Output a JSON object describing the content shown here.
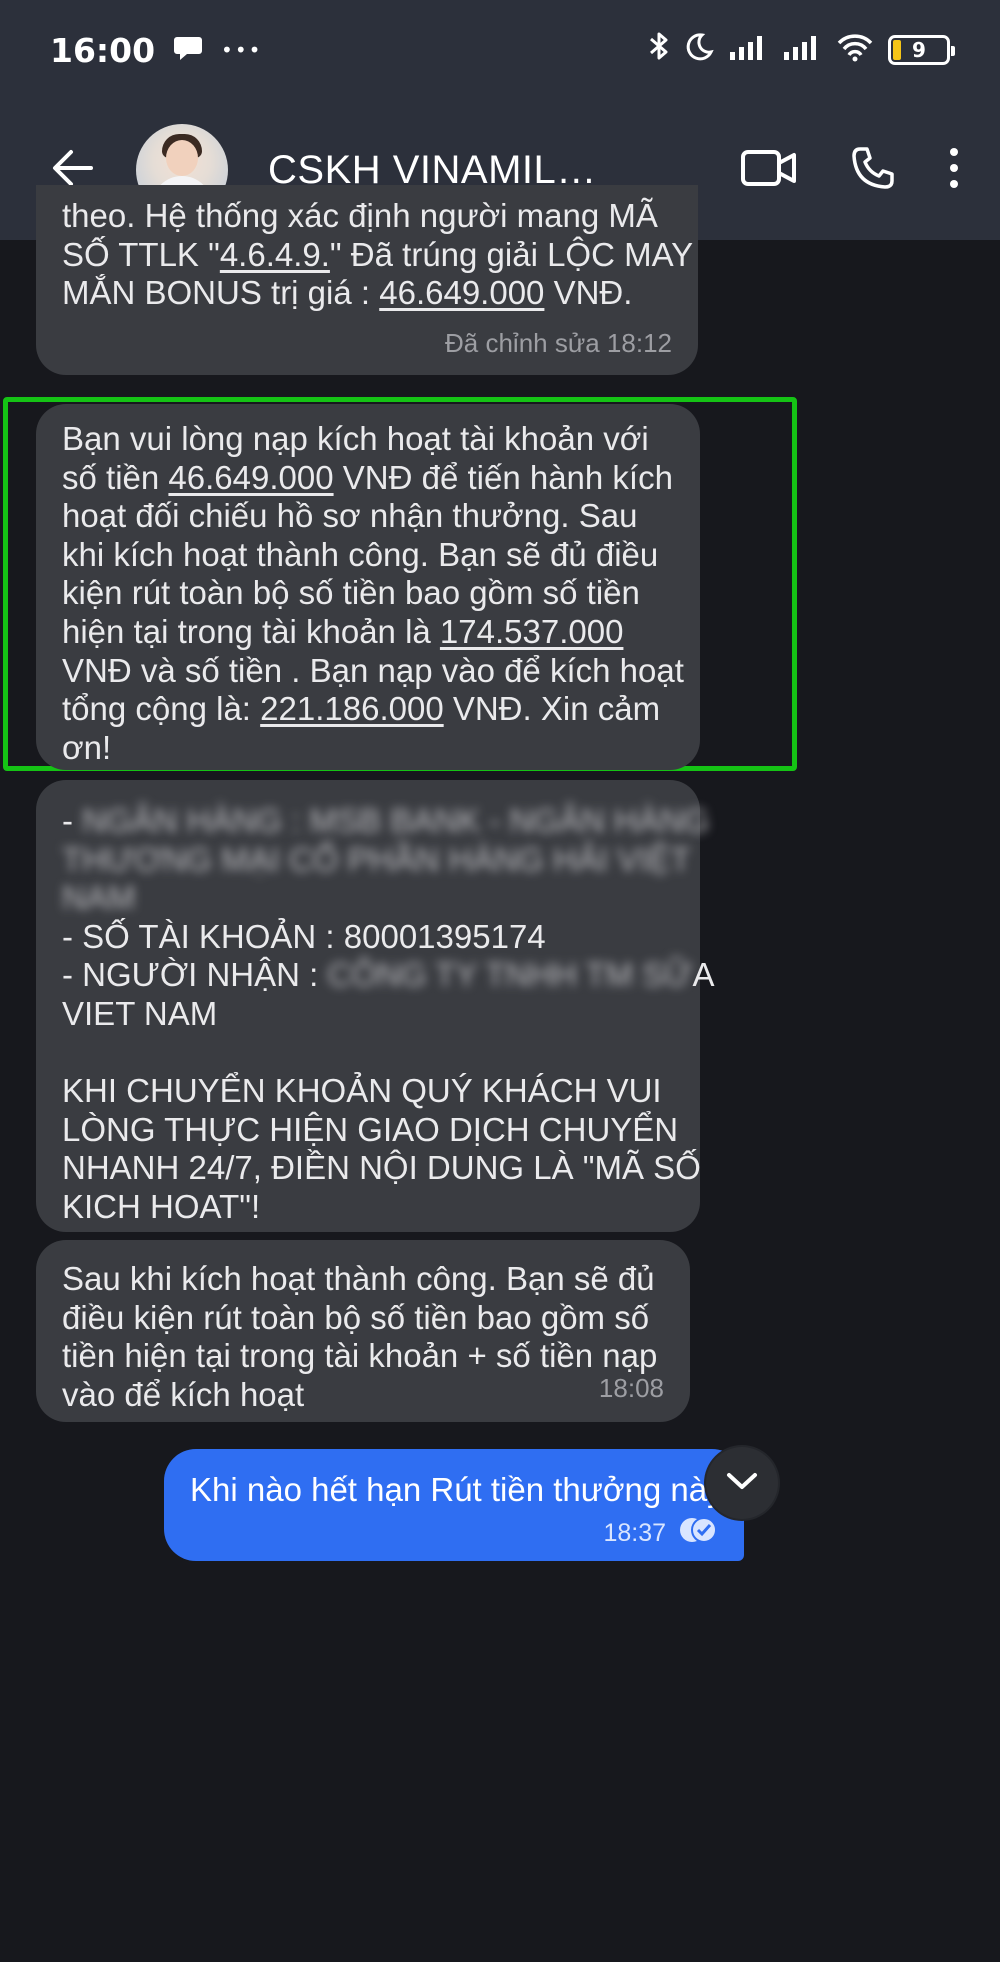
{
  "status_bar": {
    "time": "16:00",
    "dots": "•••",
    "battery": "9"
  },
  "header": {
    "contact_name": "CSKH VINAMIL…"
  },
  "messages": [
    {
      "lines": [
        [
          {
            "t": "theo. Hệ thống xác định người mang MÃ"
          }
        ],
        [
          {
            "t": "SỐ TTLK \""
          },
          {
            "t": "4.6.4.9.",
            "u": true
          },
          {
            "t": "\" Đã trúng giải LỘC MAY"
          }
        ],
        [
          {
            "t": "MẮN BONUS trị giá : "
          },
          {
            "t": "46.649.000",
            "u": true
          },
          {
            "t": " VNĐ."
          }
        ]
      ],
      "meta": "Đã chỉnh sửa 18:12"
    },
    {
      "lines": [
        [
          {
            "t": "Bạn vui lòng nạp kích hoạt tài khoản với"
          }
        ],
        [
          {
            "t": "số tiền "
          },
          {
            "t": "46.649.000",
            "u": true
          },
          {
            "t": " VNĐ để tiến hành kích"
          }
        ],
        [
          {
            "t": "hoạt đối chiếu hồ sơ nhận thưởng. Sau"
          }
        ],
        [
          {
            "t": "khi kích hoạt thành công. Bạn sẽ đủ điều"
          }
        ],
        [
          {
            "t": "kiện rút toàn bộ số tiền bao gồm số tiền"
          }
        ],
        [
          {
            "t": "hiện tại trong tài khoản là "
          },
          {
            "t": "174.537.000",
            "u": true
          }
        ],
        [
          {
            "t": "VNĐ và số tiền . Bạn nạp vào để kích hoạt"
          }
        ],
        [
          {
            "t": "tổng cộng là: "
          },
          {
            "t": "221.186.000",
            "u": true
          },
          {
            "t": " VNĐ. Xin cảm"
          }
        ],
        [
          {
            "t": "ơn!"
          }
        ]
      ]
    },
    {
      "lines": [
        [
          {
            "t": "- "
          },
          {
            "t": "NGÂN HÀNG : MSB BANK - NGÂN HÀNG",
            "blur": true
          }
        ],
        [
          {
            "t": "THƯƠNG MẠI CỔ PHẦN HÀNG HẢI VIỆT",
            "blur": true
          }
        ],
        [
          {
            "t": "NAM",
            "blur": true
          }
        ],
        [
          {
            "t": "- SỐ TÀI KHOẢN : 80001395174"
          }
        ],
        [
          {
            "t": "- NGƯỜI NHẬN : "
          },
          {
            "t": "CÔNG TY TNHH TM SỮ",
            "blur": true
          },
          {
            "t": "A"
          }
        ],
        [
          {
            "t": "VIET NAM"
          }
        ],
        [
          {
            "t": " "
          }
        ],
        [
          {
            "t": "KHI CHUYỂN KHOẢN QUÝ KHÁCH VUI"
          }
        ],
        [
          {
            "t": "LÒNG THỰC HIỆN GIAO DỊCH CHUYỂN"
          }
        ],
        [
          {
            "t": "NHANH 24/7, ĐIỀN NỘI DUNG LÀ \"MÃ SỐ"
          }
        ],
        [
          {
            "t": "KICH HOAT\"!"
          }
        ]
      ]
    },
    {
      "lines": [
        [
          {
            "t": "Sau khi kích hoạt thành công. Bạn sẽ đủ"
          }
        ],
        [
          {
            "t": "điều kiện rút toàn bộ số tiền bao gồm số"
          }
        ],
        [
          {
            "t": "tiền hiện tại trong tài khoản + số tiền nạp"
          }
        ],
        [
          {
            "t": "vào để kích hoạt"
          }
        ]
      ],
      "meta": "18:08"
    }
  ],
  "sent": {
    "text": "Khi nào hết hạn Rút tiền thưởng này",
    "time": "18:37"
  },
  "colors": {
    "highlight": "#15c315",
    "sent_bubble": "#2f6ef2",
    "received_bubble": "#3a3c41",
    "header": "#2c303b",
    "background": "#17181d"
  },
  "icons": {
    "notification": "chat-bubble-icon",
    "bluetooth": "bluetooth-icon",
    "dnd": "moon-icon",
    "signal": "signal-icon",
    "wifi": "wifi-icon",
    "back": "arrow-left-icon",
    "video": "video-call-icon",
    "call": "phone-icon",
    "more": "more-vert-icon",
    "read": "double-check-icon",
    "scroll": "chevron-down-icon"
  }
}
